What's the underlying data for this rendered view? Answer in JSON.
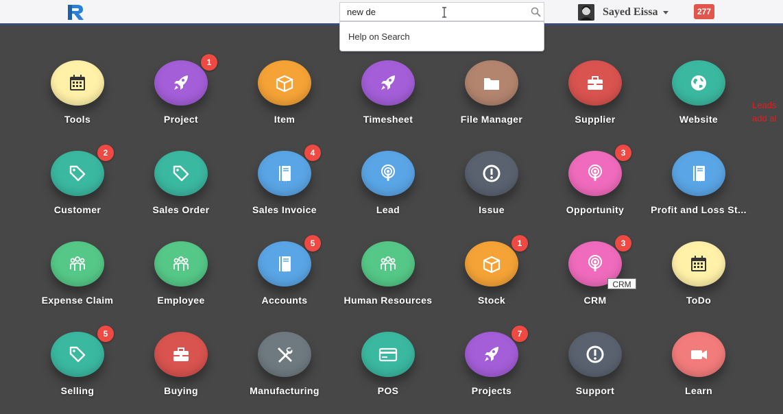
{
  "navbar": {
    "search": {
      "value": "new de"
    },
    "dropdown_item": "Help on Search",
    "user_name": "Sayed Eissa",
    "notification_count": "277"
  },
  "tooltip": "CRM",
  "side_note": [
    "Leads",
    "add al"
  ],
  "colors": {
    "yellow": "#fff1a8",
    "purple": "#a45ed8",
    "orange": "#f5a336",
    "brown": "#b3856f",
    "red": "#d9534f",
    "teal": "#3bb8a0",
    "blue": "#5aa5e6",
    "gray": "#5a6270",
    "pink": "#f06bbd",
    "green": "#55c887",
    "steel": "#6f7a80",
    "salmon": "#f27b7b",
    "badge": "#ee4a43"
  },
  "tiles": [
    {
      "label": "Tools",
      "icon": "calendar-icon",
      "color": "#fff1a8",
      "badge": ""
    },
    {
      "label": "Project",
      "icon": "rocket-icon",
      "color": "#a45ed8",
      "badge": "1"
    },
    {
      "label": "Item",
      "icon": "box-icon",
      "color": "#f5a336",
      "badge": ""
    },
    {
      "label": "Timesheet",
      "icon": "rocket-icon",
      "color": "#a45ed8",
      "badge": ""
    },
    {
      "label": "File Manager",
      "icon": "folder-icon",
      "color": "#b3856f",
      "badge": ""
    },
    {
      "label": "Supplier",
      "icon": "briefcase-icon",
      "color": "#d9534f",
      "badge": ""
    },
    {
      "label": "Website",
      "icon": "globe-icon",
      "color": "#3bb8a0",
      "badge": ""
    },
    {
      "label": "Customer",
      "icon": "tag-icon",
      "color": "#3bb8a0",
      "badge": "2"
    },
    {
      "label": "Sales Order",
      "icon": "tag-icon",
      "color": "#3bb8a0",
      "badge": ""
    },
    {
      "label": "Sales Invoice",
      "icon": "book-icon",
      "color": "#5aa5e6",
      "badge": "4"
    },
    {
      "label": "Lead",
      "icon": "podcast-icon",
      "color": "#5aa5e6",
      "badge": ""
    },
    {
      "label": "Issue",
      "icon": "alert-icon",
      "color": "#5a6270",
      "badge": ""
    },
    {
      "label": "Opportunity",
      "icon": "podcast-icon",
      "color": "#f06bbd",
      "badge": "3"
    },
    {
      "label": "Profit and Loss St...",
      "icon": "book-icon",
      "color": "#5aa5e6",
      "badge": ""
    },
    {
      "label": "Expense Claim",
      "icon": "people-icon",
      "color": "#55c887",
      "badge": ""
    },
    {
      "label": "Employee",
      "icon": "people-icon",
      "color": "#55c887",
      "badge": ""
    },
    {
      "label": "Accounts",
      "icon": "book-icon",
      "color": "#5aa5e6",
      "badge": "5"
    },
    {
      "label": "Human Resources",
      "icon": "people-icon",
      "color": "#55c887",
      "badge": ""
    },
    {
      "label": "Stock",
      "icon": "box-icon",
      "color": "#f5a336",
      "badge": "1"
    },
    {
      "label": "CRM",
      "icon": "podcast-icon",
      "color": "#f06bbd",
      "badge": "3"
    },
    {
      "label": "ToDo",
      "icon": "calendar-icon",
      "color": "#fff1a8",
      "badge": ""
    },
    {
      "label": "Selling",
      "icon": "tag-icon",
      "color": "#3bb8a0",
      "badge": "5"
    },
    {
      "label": "Buying",
      "icon": "briefcase-icon",
      "color": "#d9534f",
      "badge": ""
    },
    {
      "label": "Manufacturing",
      "icon": "tools-icon",
      "color": "#6f7a80",
      "badge": ""
    },
    {
      "label": "POS",
      "icon": "card-icon",
      "color": "#3bb8a0",
      "badge": ""
    },
    {
      "label": "Projects",
      "icon": "rocket-icon",
      "color": "#a45ed8",
      "badge": "7"
    },
    {
      "label": "Support",
      "icon": "alert-icon",
      "color": "#5a6270",
      "badge": ""
    },
    {
      "label": "Learn",
      "icon": "video-icon",
      "color": "#f27b7b",
      "badge": ""
    }
  ]
}
